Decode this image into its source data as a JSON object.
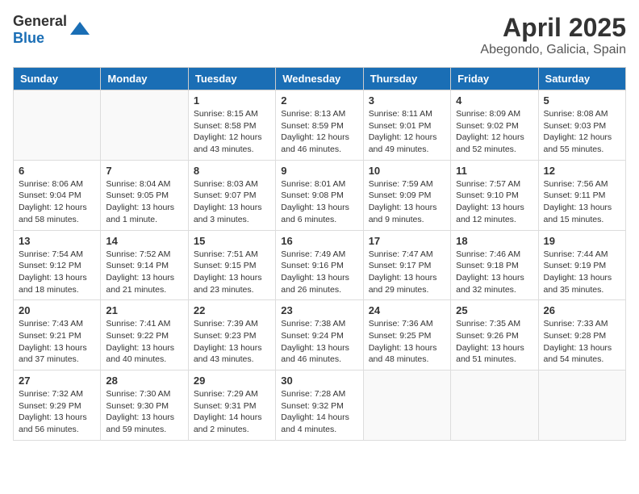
{
  "header": {
    "logo_general": "General",
    "logo_blue": "Blue",
    "title": "April 2025",
    "subtitle": "Abegondo, Galicia, Spain"
  },
  "calendar": {
    "days_of_week": [
      "Sunday",
      "Monday",
      "Tuesday",
      "Wednesday",
      "Thursday",
      "Friday",
      "Saturday"
    ],
    "weeks": [
      [
        {
          "day": "",
          "detail": ""
        },
        {
          "day": "",
          "detail": ""
        },
        {
          "day": "1",
          "detail": "Sunrise: 8:15 AM\nSunset: 8:58 PM\nDaylight: 12 hours and 43 minutes."
        },
        {
          "day": "2",
          "detail": "Sunrise: 8:13 AM\nSunset: 8:59 PM\nDaylight: 12 hours and 46 minutes."
        },
        {
          "day": "3",
          "detail": "Sunrise: 8:11 AM\nSunset: 9:01 PM\nDaylight: 12 hours and 49 minutes."
        },
        {
          "day": "4",
          "detail": "Sunrise: 8:09 AM\nSunset: 9:02 PM\nDaylight: 12 hours and 52 minutes."
        },
        {
          "day": "5",
          "detail": "Sunrise: 8:08 AM\nSunset: 9:03 PM\nDaylight: 12 hours and 55 minutes."
        }
      ],
      [
        {
          "day": "6",
          "detail": "Sunrise: 8:06 AM\nSunset: 9:04 PM\nDaylight: 12 hours and 58 minutes."
        },
        {
          "day": "7",
          "detail": "Sunrise: 8:04 AM\nSunset: 9:05 PM\nDaylight: 13 hours and 1 minute."
        },
        {
          "day": "8",
          "detail": "Sunrise: 8:03 AM\nSunset: 9:07 PM\nDaylight: 13 hours and 3 minutes."
        },
        {
          "day": "9",
          "detail": "Sunrise: 8:01 AM\nSunset: 9:08 PM\nDaylight: 13 hours and 6 minutes."
        },
        {
          "day": "10",
          "detail": "Sunrise: 7:59 AM\nSunset: 9:09 PM\nDaylight: 13 hours and 9 minutes."
        },
        {
          "day": "11",
          "detail": "Sunrise: 7:57 AM\nSunset: 9:10 PM\nDaylight: 13 hours and 12 minutes."
        },
        {
          "day": "12",
          "detail": "Sunrise: 7:56 AM\nSunset: 9:11 PM\nDaylight: 13 hours and 15 minutes."
        }
      ],
      [
        {
          "day": "13",
          "detail": "Sunrise: 7:54 AM\nSunset: 9:12 PM\nDaylight: 13 hours and 18 minutes."
        },
        {
          "day": "14",
          "detail": "Sunrise: 7:52 AM\nSunset: 9:14 PM\nDaylight: 13 hours and 21 minutes."
        },
        {
          "day": "15",
          "detail": "Sunrise: 7:51 AM\nSunset: 9:15 PM\nDaylight: 13 hours and 23 minutes."
        },
        {
          "day": "16",
          "detail": "Sunrise: 7:49 AM\nSunset: 9:16 PM\nDaylight: 13 hours and 26 minutes."
        },
        {
          "day": "17",
          "detail": "Sunrise: 7:47 AM\nSunset: 9:17 PM\nDaylight: 13 hours and 29 minutes."
        },
        {
          "day": "18",
          "detail": "Sunrise: 7:46 AM\nSunset: 9:18 PM\nDaylight: 13 hours and 32 minutes."
        },
        {
          "day": "19",
          "detail": "Sunrise: 7:44 AM\nSunset: 9:19 PM\nDaylight: 13 hours and 35 minutes."
        }
      ],
      [
        {
          "day": "20",
          "detail": "Sunrise: 7:43 AM\nSunset: 9:21 PM\nDaylight: 13 hours and 37 minutes."
        },
        {
          "day": "21",
          "detail": "Sunrise: 7:41 AM\nSunset: 9:22 PM\nDaylight: 13 hours and 40 minutes."
        },
        {
          "day": "22",
          "detail": "Sunrise: 7:39 AM\nSunset: 9:23 PM\nDaylight: 13 hours and 43 minutes."
        },
        {
          "day": "23",
          "detail": "Sunrise: 7:38 AM\nSunset: 9:24 PM\nDaylight: 13 hours and 46 minutes."
        },
        {
          "day": "24",
          "detail": "Sunrise: 7:36 AM\nSunset: 9:25 PM\nDaylight: 13 hours and 48 minutes."
        },
        {
          "day": "25",
          "detail": "Sunrise: 7:35 AM\nSunset: 9:26 PM\nDaylight: 13 hours and 51 minutes."
        },
        {
          "day": "26",
          "detail": "Sunrise: 7:33 AM\nSunset: 9:28 PM\nDaylight: 13 hours and 54 minutes."
        }
      ],
      [
        {
          "day": "27",
          "detail": "Sunrise: 7:32 AM\nSunset: 9:29 PM\nDaylight: 13 hours and 56 minutes."
        },
        {
          "day": "28",
          "detail": "Sunrise: 7:30 AM\nSunset: 9:30 PM\nDaylight: 13 hours and 59 minutes."
        },
        {
          "day": "29",
          "detail": "Sunrise: 7:29 AM\nSunset: 9:31 PM\nDaylight: 14 hours and 2 minutes."
        },
        {
          "day": "30",
          "detail": "Sunrise: 7:28 AM\nSunset: 9:32 PM\nDaylight: 14 hours and 4 minutes."
        },
        {
          "day": "",
          "detail": ""
        },
        {
          "day": "",
          "detail": ""
        },
        {
          "day": "",
          "detail": ""
        }
      ]
    ]
  }
}
